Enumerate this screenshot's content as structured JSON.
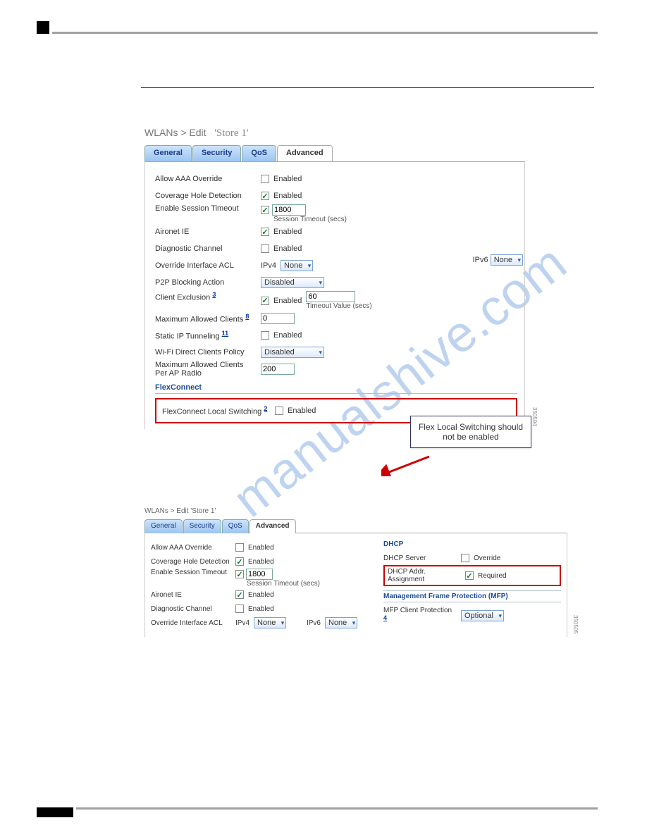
{
  "fig1": {
    "breadcrumb_prefix": "WLANs > Edit",
    "breadcrumb_title": "'Store 1'",
    "tabs": {
      "general": "General",
      "security": "Security",
      "qos": "QoS",
      "advanced": "Advanced"
    },
    "allow_aaa": {
      "label": "Allow AAA Override",
      "enabled_text": "Enabled"
    },
    "coverage": {
      "label": "Coverage Hole Detection",
      "enabled_text": "Enabled"
    },
    "session": {
      "label": "Enable Session Timeout",
      "value": "1800",
      "sub": "Session Timeout (secs)"
    },
    "aironet": {
      "label": "Aironet IE",
      "enabled_text": "Enabled"
    },
    "diag": {
      "label": "Diagnostic Channel",
      "enabled_text": "Enabled"
    },
    "override_acl": {
      "label": "Override Interface ACL",
      "ipv4_label": "IPv4",
      "ipv4_value": "None",
      "ipv6_label": "IPv6",
      "ipv6_value": "None"
    },
    "p2p": {
      "label": "P2P Blocking Action",
      "value": "Disabled"
    },
    "client_excl": {
      "label": "Client Exclusion",
      "sup": "3",
      "enabled_text": "Enabled",
      "timeout": "60",
      "timeout_sub": "Timeout Value (secs)"
    },
    "max_clients": {
      "label": "Maximum Allowed Clients",
      "sup": "8",
      "value": "0"
    },
    "static_ip": {
      "label": "Static IP Tunneling",
      "sup": "11",
      "enabled_text": "Enabled"
    },
    "wifi_direct": {
      "label": "Wi-Fi Direct Clients Policy",
      "value": "Disabled"
    },
    "max_per_ap": {
      "label": "Maximum Allowed Clients Per AP Radio",
      "value": "200"
    },
    "flexconnect_hdr": "FlexConnect",
    "flex_local": {
      "label": "FlexConnect Local Switching",
      "sup": "2",
      "enabled_text": "Enabled"
    },
    "callout": "Flex Local Switching should not be enabled",
    "img_id": "350504"
  },
  "fig2": {
    "breadcrumb": "WLANs > Edit   'Store 1'",
    "tabs": {
      "general": "General",
      "security": "Security",
      "qos": "QoS",
      "advanced": "Advanced"
    },
    "allow_aaa": {
      "label": "Allow AAA Override",
      "enabled_text": "Enabled"
    },
    "coverage": {
      "label": "Coverage Hole Detection",
      "enabled_text": "Enabled"
    },
    "session": {
      "label": "Enable Session Timeout",
      "value": "1800",
      "sub": "Session Timeout (secs)"
    },
    "aironet": {
      "label": "Aironet IE",
      "enabled_text": "Enabled"
    },
    "diag": {
      "label": "Diagnostic Channel",
      "enabled_text": "Enabled"
    },
    "override_acl": {
      "label": "Override Interface ACL",
      "ipv4_label": "IPv4",
      "ipv4_value": "None",
      "ipv6_label": "IPv6",
      "ipv6_value": "None"
    },
    "dhcp_hdr": "DHCP",
    "dhcp_server": {
      "label": "DHCP Server",
      "override_text": "Override"
    },
    "dhcp_addr": {
      "label": "DHCP Addr. Assignment",
      "required_text": "Required"
    },
    "mfp_hdr": "Management Frame Protection (MFP)",
    "mfp_client": {
      "label": "MFP Client Protection",
      "sup": "4",
      "value": "Optional"
    },
    "img_id": "350505"
  },
  "watermark": "manualshive.com"
}
